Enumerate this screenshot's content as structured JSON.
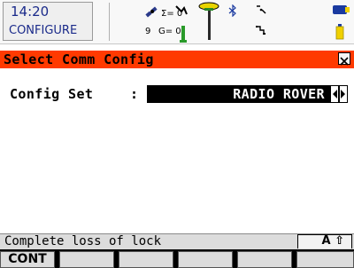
{
  "status": {
    "time": "14:20",
    "mode": "CONFIGURE",
    "sat_sum_glonass": "Σ= 0",
    "sat_gps": "9",
    "sat_g": "G= 0"
  },
  "title": "Select Comm Config",
  "field": {
    "label": "Config Set",
    "colon": ":",
    "value": "RADIO ROVER"
  },
  "message": "Complete loss of lock",
  "input_mode": "A ⇧",
  "fkeys": [
    "CONT",
    "",
    "",
    "",
    "",
    ""
  ],
  "colors": {
    "title_bar": "#ff3a00",
    "status_text": "#1a2a8a",
    "value_bg": "#000000"
  }
}
